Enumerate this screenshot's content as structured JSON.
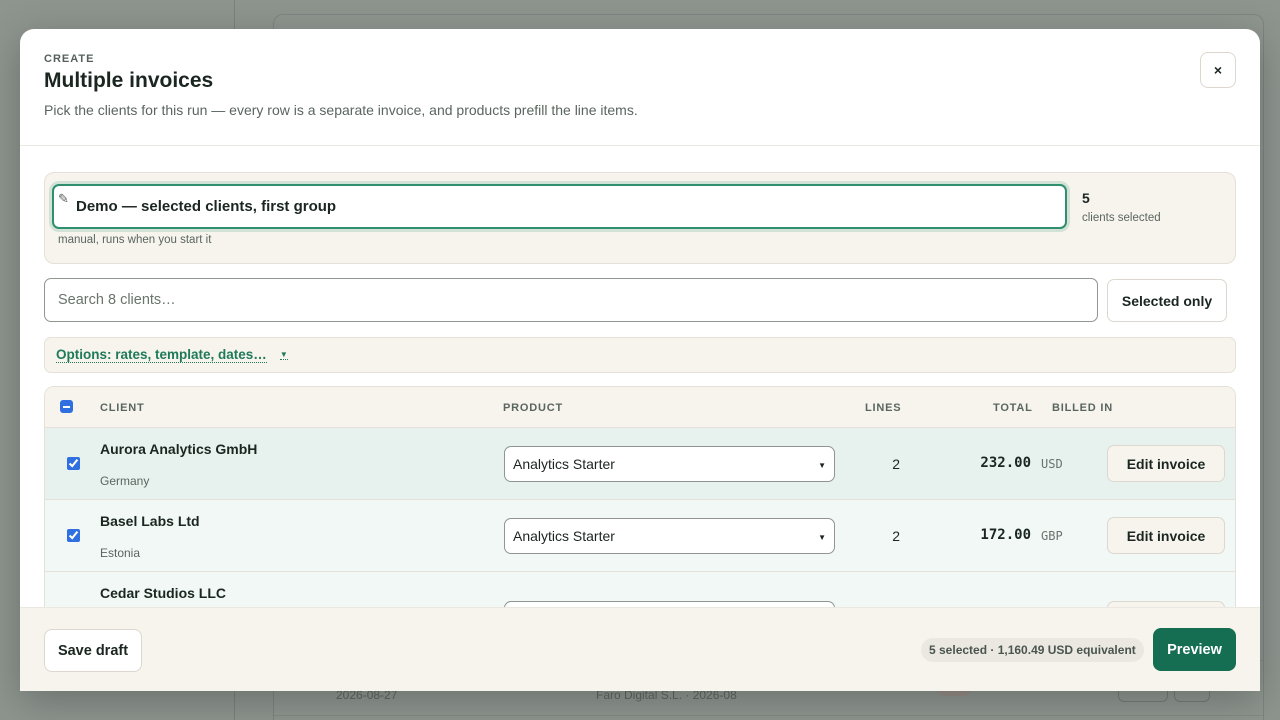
{
  "background": {
    "row_date": "2026-08-27",
    "row_desc": "Faro Digital S.L. · 2026-08"
  },
  "modal": {
    "kicker": "CREATE",
    "title": "Multiple invoices",
    "subtitle": "Pick the clients for this run — every row is a separate invoice, and products prefill the line items.",
    "close_label": "×",
    "batch": {
      "name_value": "Demo — selected clients, first group",
      "pencil_icon": "✎",
      "note": "manual, runs when you start it",
      "selected_count": "5",
      "selected_label": "clients selected"
    },
    "search": {
      "placeholder": "Search 8 clients…",
      "filter_button": "Selected only"
    },
    "options": {
      "label": "Options: rates, template, dates…",
      "caret": "▼"
    },
    "table": {
      "headers": {
        "client": "CLIENT",
        "product": "PRODUCT",
        "lines": "LINES",
        "total": "TOTAL",
        "billed_in": "BILLED IN"
      },
      "rows": [
        {
          "client": "Aurora Analytics GmbH",
          "country": "Germany",
          "product": "Analytics Starter",
          "lines": "2",
          "total": "232.00",
          "currency": "USD",
          "action": "Edit invoice",
          "checked": true
        },
        {
          "client": "Basel Labs Ltd",
          "country": "Estonia",
          "product": "Analytics Starter",
          "lines": "2",
          "total": "172.00",
          "currency": "GBP",
          "action": "Edit invoice",
          "checked": true
        },
        {
          "client": "Cedar Studios LLC",
          "country": "",
          "product": "",
          "lines": "",
          "total": "",
          "currency": "",
          "action": "",
          "checked": false
        }
      ],
      "select_caret": "▼"
    },
    "footer": {
      "save_draft": "Save draft",
      "summary": "5 selected · 1,160.49 USD equivalent",
      "preview": "Preview"
    }
  },
  "colors": {
    "accent": "#156e51",
    "focus_ring": "#2f8f6f",
    "checkbox": "#2f6fe0",
    "selected_row": "#e7f2ee"
  }
}
